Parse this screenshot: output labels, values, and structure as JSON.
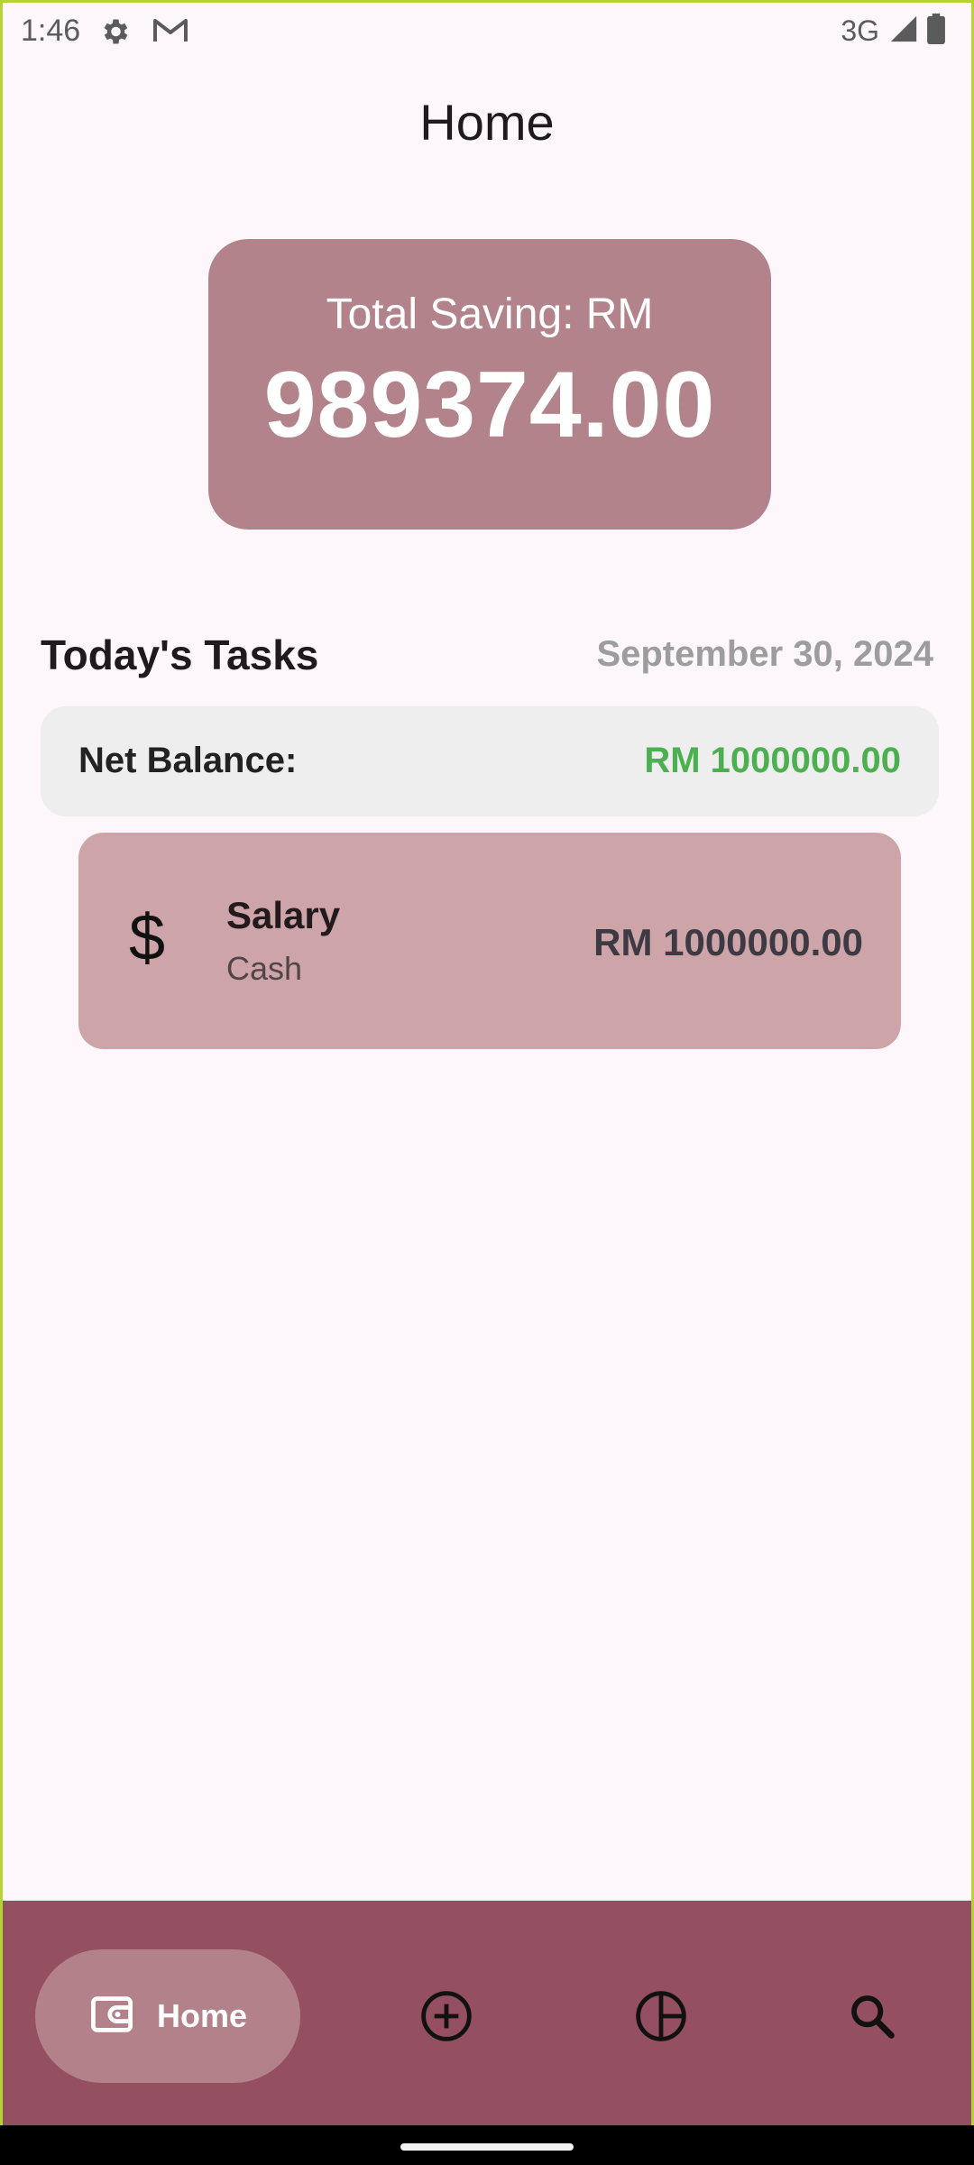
{
  "status_bar": {
    "time": "1:46",
    "network": "3G",
    "icons": [
      "gear-icon",
      "gmail-icon",
      "signal-icon",
      "battery-icon"
    ]
  },
  "header": {
    "title": "Home"
  },
  "saving_card": {
    "label": "Total Saving: RM",
    "value": "989374.00",
    "color": "#b3838c"
  },
  "tasks": {
    "title": "Today's Tasks",
    "date": "September 30, 2024"
  },
  "net_balance": {
    "label": "Net Balance:",
    "value": "RM 1000000.00",
    "value_color": "#4caf50"
  },
  "transactions": [
    {
      "icon": "dollar-icon",
      "icon_glyph": "$",
      "title": "Salary",
      "subtitle": "Cash",
      "amount": "RM 1000000.00"
    }
  ],
  "bottom_nav": {
    "color": "#944f61",
    "items": [
      {
        "label": "Home",
        "icon": "wallet-icon",
        "active": true
      },
      {
        "icon": "add-circle-icon",
        "active": false
      },
      {
        "icon": "pie-chart-icon",
        "active": false
      },
      {
        "icon": "search-icon",
        "active": false
      }
    ]
  }
}
